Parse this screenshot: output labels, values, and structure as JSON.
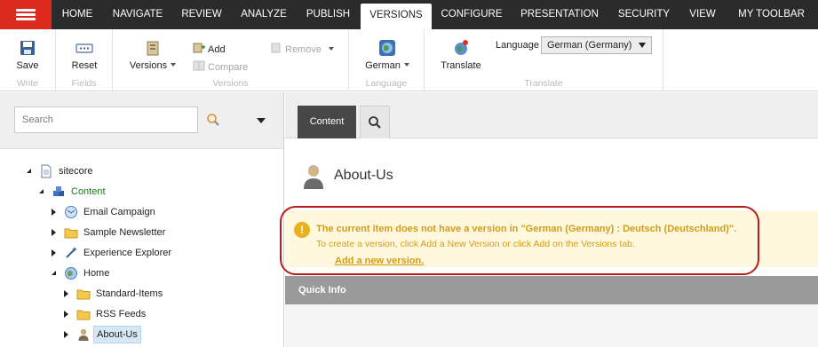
{
  "menu": {
    "tabs": [
      {
        "label": "HOME"
      },
      {
        "label": "NAVIGATE"
      },
      {
        "label": "REVIEW"
      },
      {
        "label": "ANALYZE"
      },
      {
        "label": "PUBLISH"
      },
      {
        "label": "VERSIONS",
        "active": true
      },
      {
        "label": "CONFIGURE"
      },
      {
        "label": "PRESENTATION"
      },
      {
        "label": "SECURITY"
      },
      {
        "label": "VIEW"
      },
      {
        "label": "MY TOOLBAR"
      }
    ]
  },
  "ribbon": {
    "write": {
      "label": "Write",
      "save": "Save"
    },
    "fields": {
      "label": "Fields",
      "reset": "Reset"
    },
    "versions": {
      "label": "Versions",
      "versions_button": "Versions",
      "add": "Add",
      "compare": "Compare",
      "remove": "Remove"
    },
    "language": {
      "label": "Language",
      "language_button": "German"
    },
    "translate": {
      "label": "Translate",
      "translate_button": "Translate",
      "language_label": "Language",
      "language_value": "German (Germany)"
    }
  },
  "tree": {
    "search_placeholder": "Search",
    "nodes": [
      {
        "label": "sitecore",
        "icon": "document-icon",
        "state": "expanded"
      },
      {
        "label": "Content",
        "icon": "content-cubes-icon",
        "state": "expanded"
      },
      {
        "label": "Email Campaign",
        "icon": "email-campaign-icon",
        "state": "collapsed"
      },
      {
        "label": "Sample Newsletter",
        "icon": "folder-icon",
        "state": "collapsed"
      },
      {
        "label": "Experience Explorer",
        "icon": "explorer-wand-icon",
        "state": "collapsed"
      },
      {
        "label": "Home",
        "icon": "globe-icon",
        "state": "expanded"
      },
      {
        "label": "Standard-Items",
        "icon": "folder-icon",
        "state": "collapsed"
      },
      {
        "label": "RSS Feeds",
        "icon": "folder-icon",
        "state": "collapsed"
      },
      {
        "label": "About-Us",
        "icon": "person-icon",
        "state": "collapsed",
        "selected": true
      }
    ]
  },
  "editor": {
    "tab_content": "Content",
    "item_title": "About-Us",
    "warning": {
      "icon_glyph": "!",
      "title": "The current item does not have a version in \"German (Germany) : Deutsch (Deutschland)\".",
      "text": "To create a version, click Add a New Version or click Add on the Versions tab.",
      "link": "Add a new version."
    },
    "quick_info": "Quick Info"
  },
  "colors": {
    "topbar": "#2b2b2b",
    "hamburger": "#dc291e",
    "warning_text": "#d29d16",
    "warning_bg": "#fff8de",
    "annotation": "#b71c1c"
  }
}
